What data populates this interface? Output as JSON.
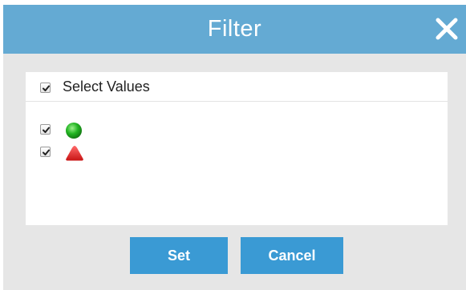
{
  "dialog": {
    "title": "Filter",
    "close_icon": "close-icon",
    "header_color": "#64aad3"
  },
  "filter": {
    "select_all_label": "Select Values",
    "select_all_checked": true,
    "items": [
      {
        "icon": "green-circle-icon",
        "color": "#22b422",
        "checked": true
      },
      {
        "icon": "red-triangle-icon",
        "color": "#dd2222",
        "checked": true
      }
    ]
  },
  "buttons": {
    "set_label": "Set",
    "cancel_label": "Cancel",
    "color": "#3a9ad4"
  }
}
